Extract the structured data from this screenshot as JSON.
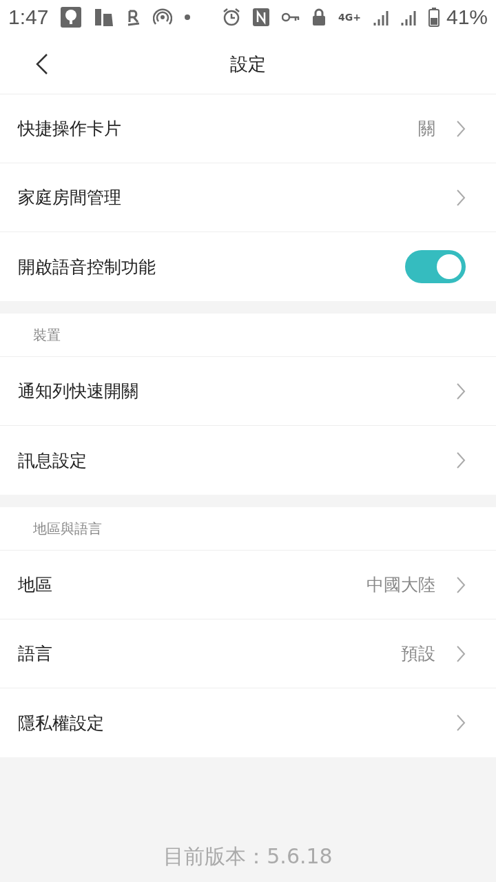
{
  "status_bar": {
    "time": "1:47",
    "network": "4G+",
    "battery": "41%"
  },
  "header": {
    "title": "設定"
  },
  "sections": [
    {
      "rows": [
        {
          "kind": "link",
          "label": "快捷操作卡片",
          "value": "關"
        },
        {
          "kind": "link",
          "label": "家庭房間管理"
        },
        {
          "kind": "toggle",
          "label": "開啟語音控制功能",
          "on": true
        }
      ]
    },
    {
      "title": "裝置",
      "rows": [
        {
          "kind": "link",
          "label": "通知列快速開關"
        },
        {
          "kind": "link",
          "label": "訊息設定"
        }
      ]
    },
    {
      "title": "地區與語言",
      "rows": [
        {
          "kind": "link",
          "label": "地區",
          "value": "中國大陸"
        },
        {
          "kind": "link",
          "label": "語言",
          "value": "預設"
        },
        {
          "kind": "link",
          "label": "隱私權設定"
        }
      ]
    }
  ],
  "footer": {
    "version": "目前版本：5.6.18"
  }
}
